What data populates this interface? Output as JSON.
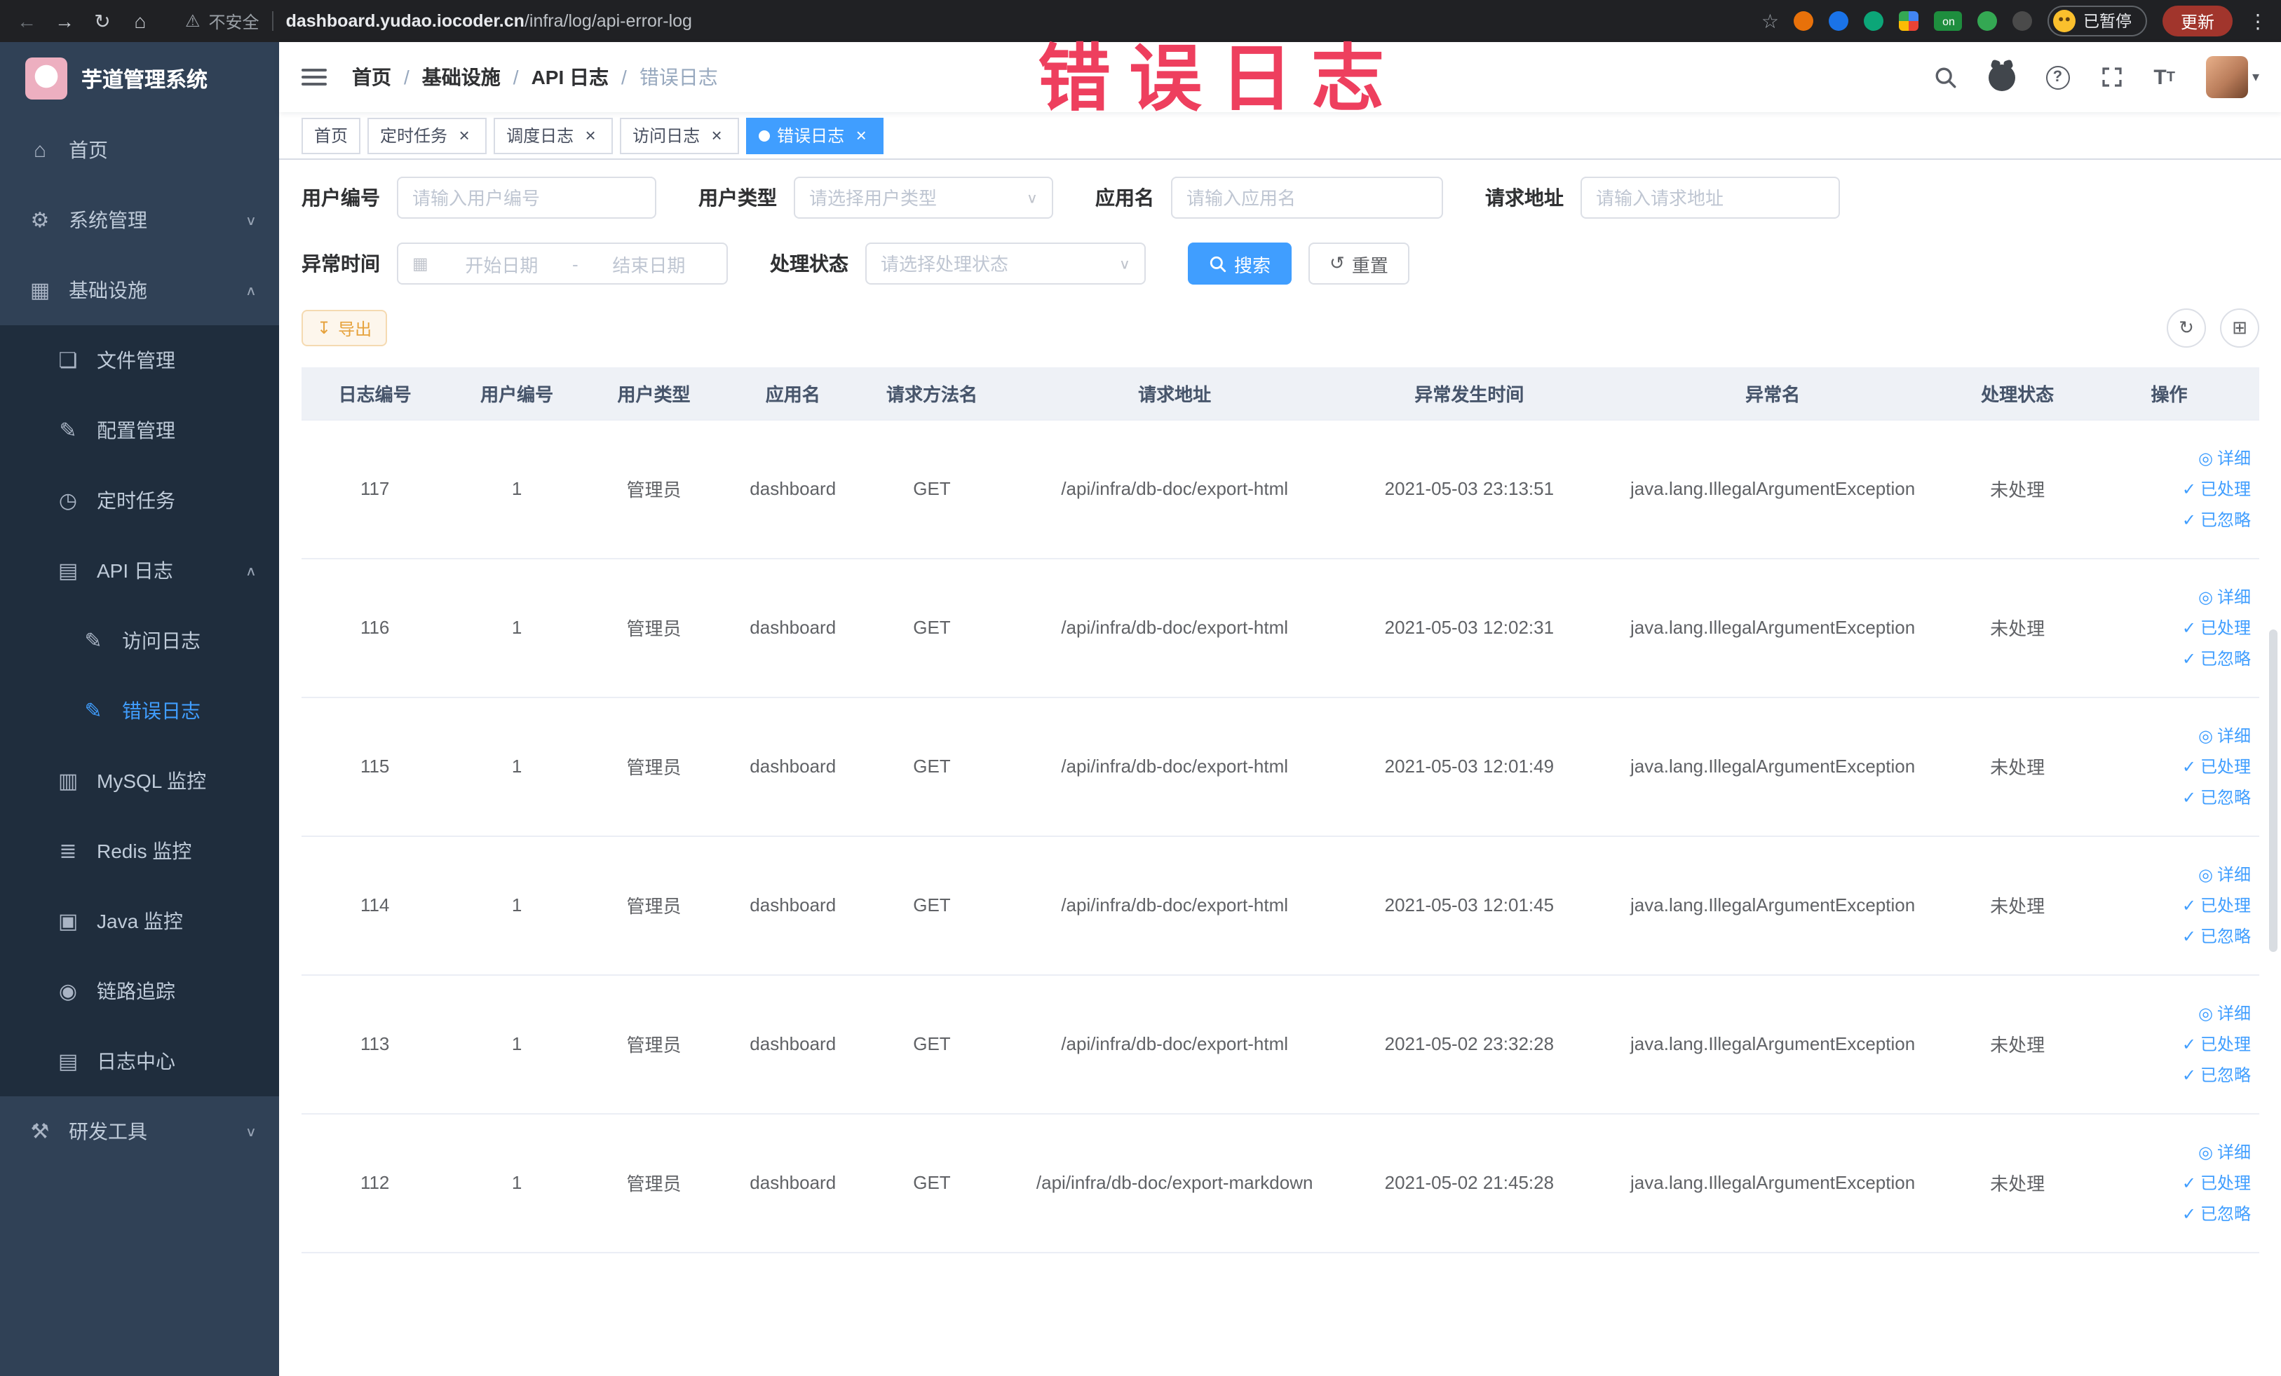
{
  "browser": {
    "security_label": "不安全",
    "url_domain": "dashboard.yudao.iocoder.cn",
    "url_path": "/infra/log/api-error-log",
    "extension_badge": "on",
    "paused_label": "已暂停",
    "update_label": "更新"
  },
  "watermark": "错误日志",
  "icons": {
    "back": "←",
    "forward": "→",
    "reload": "↻",
    "home": "⌂",
    "warning": "⚠",
    "star": "☆",
    "menu_dots": "⋮",
    "home_menu": "⌂",
    "gear": "⚙",
    "infra": "▦",
    "file": "❏",
    "config": "✎",
    "timer": "◷",
    "api_log": "▤",
    "access_log": "✎",
    "error_log": "✎",
    "mysql": "▥",
    "redis": "≣",
    "java": "▣",
    "trace": "◉",
    "log_center": "▤",
    "tools": "⚒",
    "chevron_down": "∨",
    "chevron_up": "∧",
    "caret_down": "▾",
    "close": "×",
    "calendar": "▦",
    "reset": "↺",
    "export": "↧",
    "refresh": "↻",
    "columns": "⊞",
    "eye": "◎",
    "check": "✓"
  },
  "sidebar": {
    "logo_title": "芋道管理系统",
    "items": [
      {
        "label": "首页"
      },
      {
        "label": "系统管理"
      },
      {
        "label": "基础设施"
      },
      {
        "label": "文件管理"
      },
      {
        "label": "配置管理"
      },
      {
        "label": "定时任务"
      },
      {
        "label": "API 日志"
      },
      {
        "label": "访问日志"
      },
      {
        "label": "错误日志"
      },
      {
        "label": "MySQL 监控"
      },
      {
        "label": "Redis 监控"
      },
      {
        "label": "Java 监控"
      },
      {
        "label": "链路追踪"
      },
      {
        "label": "日志中心"
      },
      {
        "label": "研发工具"
      }
    ]
  },
  "header": {
    "breadcrumb": [
      "首页",
      "基础设施",
      "API 日志",
      "错误日志"
    ],
    "separator": "/"
  },
  "tabs": [
    {
      "label": "首页"
    },
    {
      "label": "定时任务"
    },
    {
      "label": "调度日志"
    },
    {
      "label": "访问日志"
    },
    {
      "label": "错误日志"
    }
  ],
  "filters": {
    "user_id": {
      "label": "用户编号",
      "placeholder": "请输入用户编号"
    },
    "user_type": {
      "label": "用户类型",
      "placeholder": "请选择用户类型"
    },
    "app_name": {
      "label": "应用名",
      "placeholder": "请输入应用名"
    },
    "request_url": {
      "label": "请求地址",
      "placeholder": "请输入请求地址"
    },
    "exception_time": {
      "label": "异常时间",
      "start_placeholder": "开始日期",
      "separator": "-",
      "end_placeholder": "结束日期"
    },
    "process_status": {
      "label": "处理状态",
      "placeholder": "请选择处理状态"
    },
    "search_label": "搜索",
    "reset_label": "重置"
  },
  "toolbar": {
    "export_label": "导出"
  },
  "table": {
    "columns": [
      "日志编号",
      "用户编号",
      "用户类型",
      "应用名",
      "请求方法名",
      "请求地址",
      "异常发生时间",
      "异常名",
      "处理状态",
      "操作"
    ],
    "action_labels": [
      "详细",
      "已处理",
      "已忽略"
    ],
    "rows": [
      {
        "id": "117",
        "user_id": "1",
        "user_type": "管理员",
        "app": "dashboard",
        "method": "GET",
        "url": "/api/infra/db-doc/export-html",
        "time": "2021-05-03 23:13:51",
        "exception": "java.lang.IllegalArgumentException",
        "status": "未处理"
      },
      {
        "id": "116",
        "user_id": "1",
        "user_type": "管理员",
        "app": "dashboard",
        "method": "GET",
        "url": "/api/infra/db-doc/export-html",
        "time": "2021-05-03 12:02:31",
        "exception": "java.lang.IllegalArgumentException",
        "status": "未处理"
      },
      {
        "id": "115",
        "user_id": "1",
        "user_type": "管理员",
        "app": "dashboard",
        "method": "GET",
        "url": "/api/infra/db-doc/export-html",
        "time": "2021-05-03 12:01:49",
        "exception": "java.lang.IllegalArgumentException",
        "status": "未处理"
      },
      {
        "id": "114",
        "user_id": "1",
        "user_type": "管理员",
        "app": "dashboard",
        "method": "GET",
        "url": "/api/infra/db-doc/export-html",
        "time": "2021-05-03 12:01:45",
        "exception": "java.lang.IllegalArgumentException",
        "status": "未处理"
      },
      {
        "id": "113",
        "user_id": "1",
        "user_type": "管理员",
        "app": "dashboard",
        "method": "GET",
        "url": "/api/infra/db-doc/export-html",
        "time": "2021-05-02 23:32:28",
        "exception": "java.lang.IllegalArgumentException",
        "status": "未处理"
      },
      {
        "id": "112",
        "user_id": "1",
        "user_type": "管理员",
        "app": "dashboard",
        "method": "GET",
        "url": "/api/infra/db-doc/export-markdown",
        "time": "2021-05-02 21:45:28",
        "exception": "java.lang.IllegalArgumentException",
        "status": "未处理"
      }
    ]
  }
}
